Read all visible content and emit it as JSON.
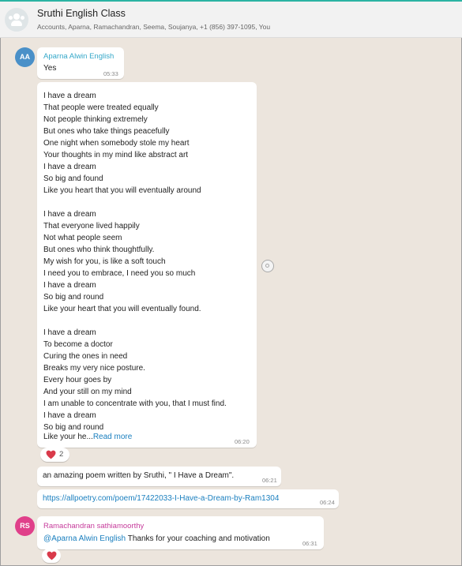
{
  "header": {
    "title": "Sruthi English Class",
    "members": "Accounts, Aparna, Ramachandran, Seema, Soujanya, +1 (856) 397-1095, You"
  },
  "messages": {
    "m1": {
      "avatar_initials": "AA",
      "sender": "Aparna Alwin English",
      "text": "Yes",
      "time": "05:33"
    },
    "m2": {
      "lines": [
        "I have a dream",
        "That people were treated equally",
        "Not people thinking extremely",
        "But ones who take things peacefully",
        "One night when somebody stole my heart",
        "Your thoughts in my mind like abstract art",
        "I have a dream",
        "So big and found",
        "Like you heart that you will eventually around",
        "",
        "I have a dream",
        "That everyone lived happily",
        "Not what people seem",
        "But ones who think thoughtfully.",
        "My wish for you, is like a soft touch",
        "I need you to embrace, I need you so much",
        "I have a dream",
        "So big and round",
        "Like your heart that you will eventually found.",
        "",
        "I have a dream",
        "To become a doctor",
        "Curing the ones in need",
        " Breaks my very nice posture.",
        "Every hour goes by",
        "And your still on my mind",
        "I am unable to concentrate with you, that I must find.",
        "I have a dream",
        "So big and round"
      ],
      "last_line": "Like your he...",
      "read_more": "Read more",
      "time": "06:20",
      "reaction_count": "2"
    },
    "m3": {
      "text": "an amazing poem written by Sruthi, \" I Have a Dream\".",
      "time": "06:21"
    },
    "m4": {
      "link": "https://allpoetry.com/poem/17422033-I-Have-a-Dream-by-Ram1304",
      "time": "06:24"
    },
    "m5": {
      "avatar_initials": "RS",
      "sender": "Ramachandran sathiamoorthy",
      "mention": "@Aparna Alwin English",
      "text": " Thanks for your coaching and motivation",
      "time": "06:31"
    }
  },
  "colors": {
    "aa_avatar": "#4a90c8",
    "rs_avatar": "#e0408a",
    "aa_name": "#35a8c9",
    "rs_name": "#c63b9b",
    "link": "#1a7fbf",
    "heart": "#d93a4a"
  },
  "icons": {
    "group": "group-avatar-icon",
    "forward": "forward-icon",
    "heart": "heart-icon"
  }
}
